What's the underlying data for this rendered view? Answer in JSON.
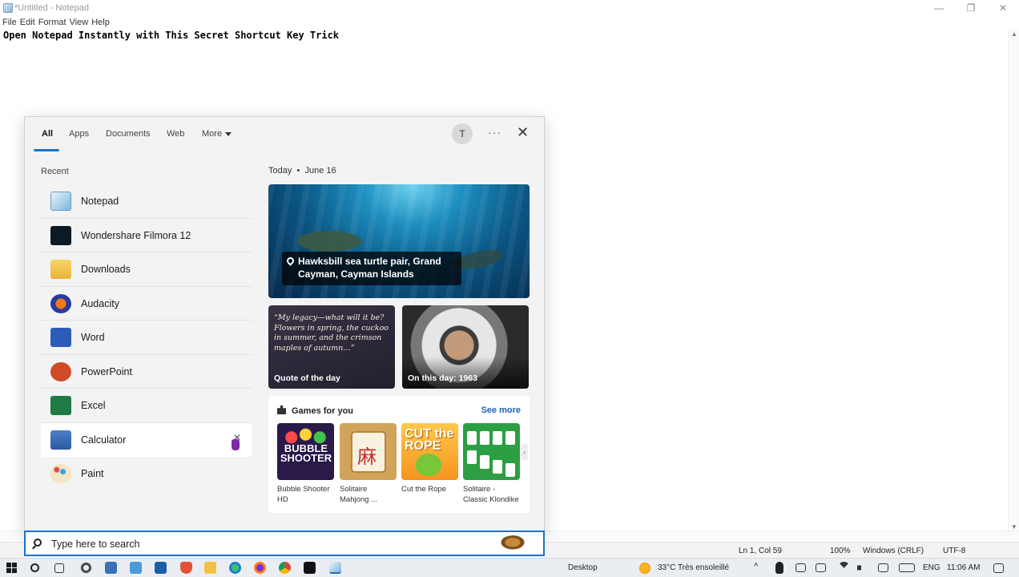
{
  "notepad": {
    "title": "*Untitled - Notepad",
    "menu": [
      "File",
      "Edit",
      "Format",
      "View",
      "Help"
    ],
    "content": "Open Notepad Instantly with This Secret Shortcut Key Trick",
    "status": {
      "position": "Ln 1, Col 59",
      "zoom": "100%",
      "line_ending": "Windows (CRLF)",
      "encoding": "UTF-8"
    }
  },
  "search_panel": {
    "tabs": [
      "All",
      "Apps",
      "Documents",
      "Web",
      "More"
    ],
    "active_tab": "All",
    "avatar_initial": "T",
    "more_options": "···",
    "recent_heading": "Recent",
    "recent": [
      {
        "label": "Notepad",
        "icon": "notepad-icon"
      },
      {
        "label": "Wondershare Filmora 12",
        "icon": "filmora-icon"
      },
      {
        "label": "Downloads",
        "icon": "folder-downloads-icon"
      },
      {
        "label": "Audacity",
        "icon": "audacity-icon"
      },
      {
        "label": "Word",
        "icon": "word-icon"
      },
      {
        "label": "PowerPoint",
        "icon": "powerpoint-icon"
      },
      {
        "label": "Excel",
        "icon": "excel-icon"
      },
      {
        "label": "Calculator",
        "icon": "calculator-icon"
      },
      {
        "label": "Paint",
        "icon": "paint-icon"
      }
    ],
    "today": {
      "label": "Today",
      "separator": "•",
      "date": "June 16"
    },
    "hero_caption": "Hawksbill sea turtle pair, Grand Cayman, Cayman Islands",
    "quote_text": "“My legacy—what will it be? Flowers in spring, the cuckoo in summer, and the crimson maples of autumn…”",
    "quote_label": "Quote of the day",
    "on_this_day_label": "On this day: 1963",
    "games": {
      "heading": "Games for you",
      "see_more": "See more",
      "items": [
        {
          "name": "Bubble Shooter HD",
          "tile_text": "BUBBLE SHOOTER"
        },
        {
          "name": "Solitaire Mahjong ...",
          "tile_text": ""
        },
        {
          "name": "Cut the Rope",
          "tile_text": "CUT the ROPE"
        },
        {
          "name": "Solitaire - Classic Klondike",
          "tile_text": ""
        }
      ]
    },
    "search_placeholder": "Type here to search"
  },
  "taskbar": {
    "desktop_label": "Desktop",
    "weather": "33°C  Très ensoleillé",
    "language": "ENG",
    "time": "11:06 AM"
  },
  "colors": {
    "accent": "#1b73c9",
    "see_more": "#1b62b8",
    "panel_bg": "#f3f3f3"
  }
}
